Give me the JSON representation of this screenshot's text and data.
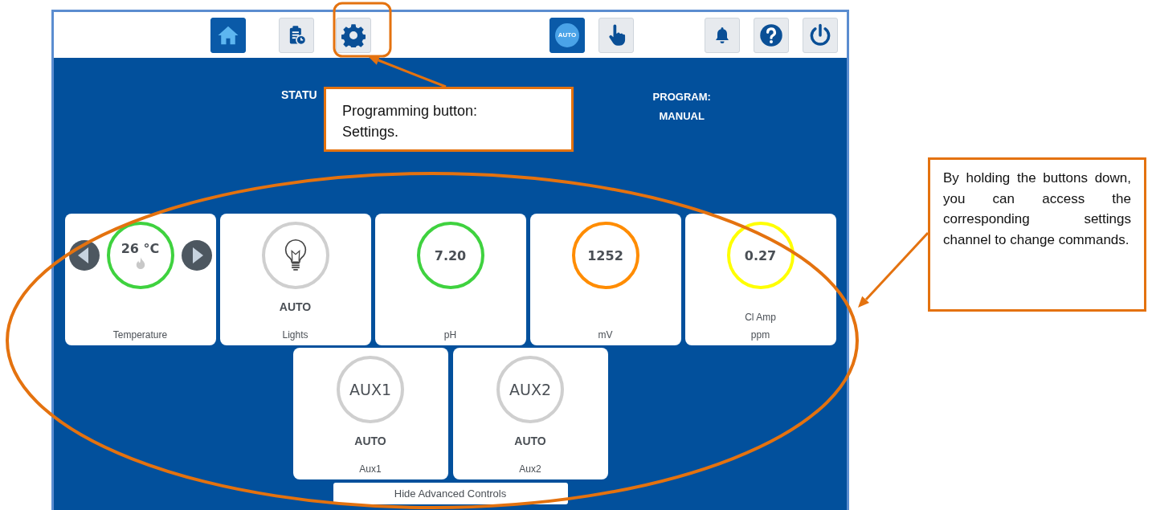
{
  "toolbar": {
    "buttons": [
      {
        "kind": "home",
        "selected": true
      },
      {
        "kind": "schedule",
        "selected": false
      },
      {
        "kind": "settings",
        "selected": false
      },
      {
        "kind": "auto",
        "label": "AUTO",
        "selected": true
      },
      {
        "kind": "manual",
        "selected": false
      },
      {
        "kind": "alarm",
        "selected": false
      },
      {
        "kind": "help",
        "selected": false
      },
      {
        "kind": "power",
        "selected": false
      }
    ]
  },
  "status": {
    "label": "STATU"
  },
  "program": {
    "label": "PROGRAM:",
    "value": "MANUAL"
  },
  "cards": [
    {
      "kind": "temperature",
      "value": "26 °C",
      "label": "Temperature",
      "color": "#3fd23f"
    },
    {
      "kind": "light",
      "mode": "AUTO",
      "label": "Lights",
      "color": "#cfcfcf"
    },
    {
      "kind": "reading",
      "value": "7.20",
      "label": "pH",
      "color": "#3fd23f"
    },
    {
      "kind": "reading",
      "value": "1252",
      "label": "mV",
      "color": "#ff8c00"
    },
    {
      "kind": "reading",
      "value": "0.27",
      "sublabel": "Cl Amp",
      "label": "ppm",
      "color": "#ffff00"
    }
  ],
  "aux_cards": [
    {
      "value": "AUX1",
      "mode": "AUTO",
      "label": "Aux1",
      "color": "#cfcfcf"
    },
    {
      "value": "AUX2",
      "mode": "AUTO",
      "label": "Aux2",
      "color": "#cfcfcf"
    }
  ],
  "hide_button": "Hide Advanced Controls",
  "annotations": [
    {
      "text": "Programming button:\nSettings."
    },
    {
      "text": "By holding the buttons down, you can access the corresponding settings channel to change commands."
    }
  ]
}
